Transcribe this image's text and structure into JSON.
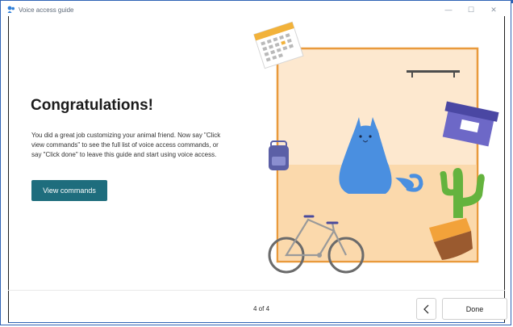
{
  "window": {
    "title": "Voice access guide",
    "minimize": "—",
    "maximize": "☐",
    "close": "✕"
  },
  "content": {
    "heading": "Congratulations!",
    "description": "You did a great job customizing your animal friend. Now say \"Click view commands\" to see the full list of voice access commands, or say \"Click done\" to leave this guide and start using voice access.",
    "primary_button": "View commands"
  },
  "footer": {
    "page_indicator": "4 of 4",
    "back_icon": "chevron-left-icon",
    "done_label": "Done"
  },
  "colors": {
    "accent": "#1e6d7d",
    "frame": "#2f63b5",
    "room_border": "#e99a3c",
    "wall": "#fde8cf",
    "floor": "#fbd9ac",
    "cat": "#4a8fe0"
  }
}
